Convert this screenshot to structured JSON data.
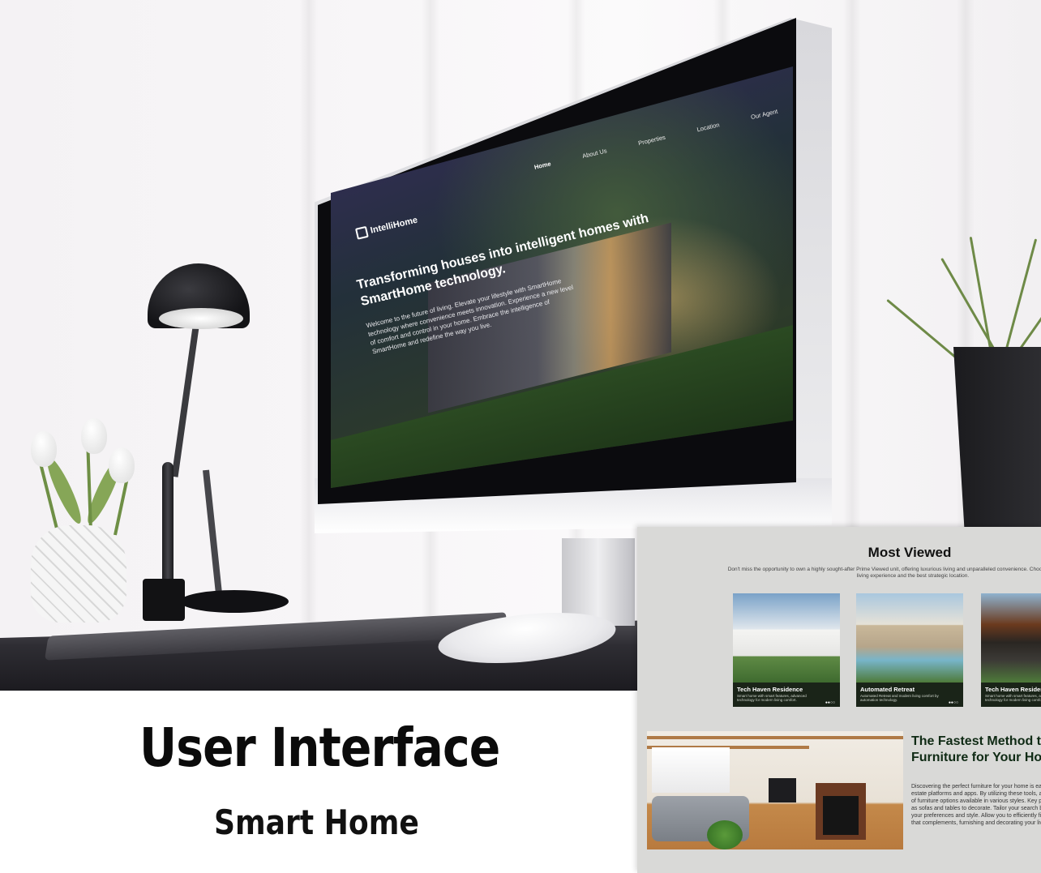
{
  "screen_site": {
    "brand": "IntelliHome",
    "nav": [
      "Home",
      "About Us",
      "Properties",
      "Location",
      "Our Agent"
    ],
    "hero_title": "Transforming houses into intelligent homes with SmartHome technology.",
    "hero_description": "Welcome to the future of living. Elevate your lifestyle with SmartHome technology where convenience meets innovation. Experience a new level of comfort and control in your home. Embrace the intelligence of SmartHome and redefine the way you live."
  },
  "caption": {
    "title": "User Interface",
    "subtitle": "Smart Home"
  },
  "preview": {
    "most_viewed_title": "Most Viewed",
    "most_viewed_desc": "Don't miss the opportunity to own a highly sought-after Prime Viewed unit, offering luxurious living and unparalleled convenience. Choose our unit for a modern living experience and the best strategic location.",
    "cards": [
      {
        "title": "Tech Haven Residence",
        "desc": "Smart home with smart features, advanced technology for modern living comfort."
      },
      {
        "title": "Automated Retreat",
        "desc": "Automated Retreat and modern living comfort by automation technology."
      },
      {
        "title": "Tech Haven Residence",
        "desc": "Smart home with smart features, advanced technology for modern living comfort."
      }
    ],
    "card_arrows": "●●○○",
    "furniture_title": "The Fastest Method to Find Furniture for Your Home",
    "furniture_desc": "Discovering the perfect furniture for your home is easy with real estate platforms and apps. By utilizing these tools, a wide range of furniture options available in various styles. Key pieces such as sofas and tables to decorate. Tailor your search based on your preferences and style. Allow you to efficiently find furniture that complements, furnishing and decorating your living space."
  },
  "colors": {
    "screen_accent": "#3a2a63",
    "preview_bg": "#d9d9d7",
    "card_dark": "#1a2418",
    "furniture_title": "#0f2a14"
  }
}
